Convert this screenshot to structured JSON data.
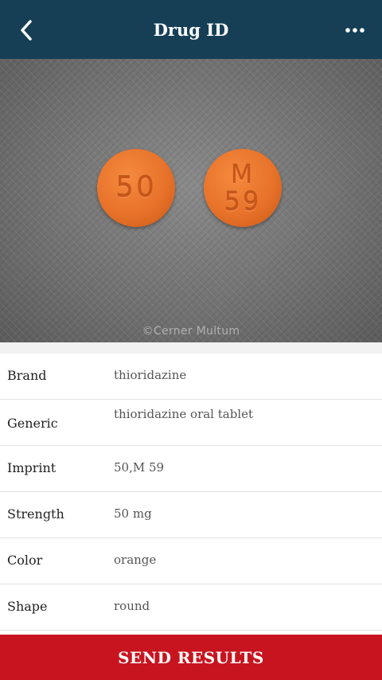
{
  "header": {
    "title": "Drug ID",
    "back_icon": "chevron-left-icon",
    "menu_icon": "more-horizontal-icon",
    "background_color": "#163f56"
  },
  "image": {
    "pill_1": {
      "imprint_lines": [
        "50"
      ]
    },
    "pill_2": {
      "imprint_lines": [
        "M",
        "59"
      ]
    },
    "pill_color": "#e8722a",
    "watermark": "©Cerner Multum"
  },
  "details": [
    {
      "label": "Brand",
      "value": "thioridazine"
    },
    {
      "label": "Generic",
      "value": "thioridazine oral tablet"
    },
    {
      "label": "Imprint",
      "value": "50,M 59"
    },
    {
      "label": "Strength",
      "value": "50 mg"
    },
    {
      "label": "Color",
      "value": "orange"
    },
    {
      "label": "Shape",
      "value": "round"
    }
  ],
  "footer": {
    "send_label": "SEND RESULTS",
    "background_color": "#c8141f"
  }
}
